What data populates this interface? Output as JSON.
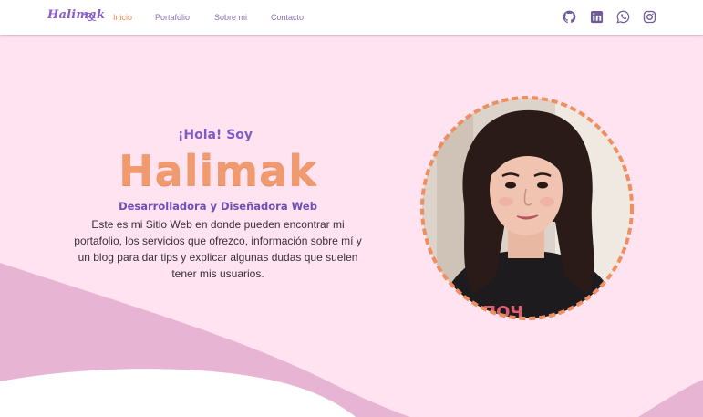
{
  "nav": {
    "logo": "Halimak",
    "links": [
      "Inicio",
      "Portafolio",
      "Sobre mi",
      "Contacto"
    ],
    "active_index": 0,
    "social_icons": [
      "github-icon",
      "linkedin-icon",
      "whatsapp-icon",
      "instagram-icon"
    ]
  },
  "hero": {
    "greeting": "¡Hola! Soy",
    "name": "Halimak",
    "role": "Desarrolladora y Diseñadora Web",
    "description": "Este es mi Sitio Web en donde pueden encontrar mi portafolio, los servicios que ofrezco, información sobre mí y un blog para dar tips y explicar algunas dudas que suelen tener mis usuarios.",
    "photo": "profile-photo"
  },
  "colors": {
    "background": "#ffe3f0",
    "accent_orange": "#f09a6f",
    "accent_purple": "#7f5cc4",
    "wave_pink": "#e8b4d3",
    "nav_bg": "#ffffff"
  }
}
